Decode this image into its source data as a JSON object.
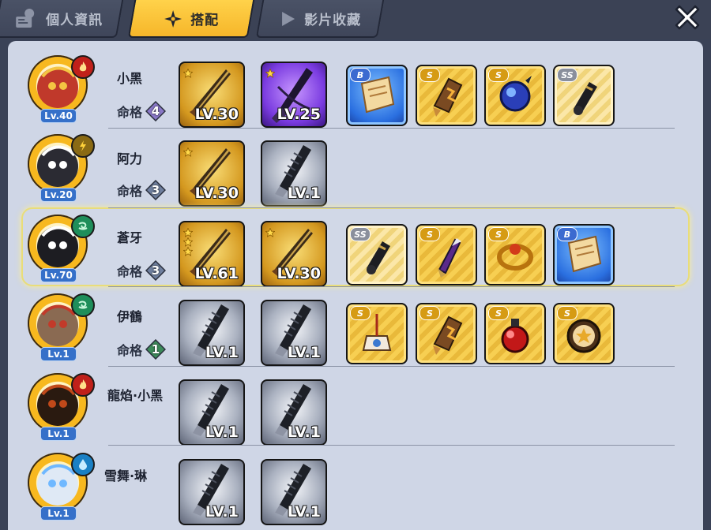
{
  "tabs": [
    {
      "label": "個人資訊",
      "active": false
    },
    {
      "label": "搭配",
      "active": true
    },
    {
      "label": "影片收藏",
      "active": false
    }
  ],
  "close_icon": "close-icon",
  "mingge_label": "命格",
  "characters": [
    {
      "name": "小黑",
      "level": "Lv.40",
      "element": "fire",
      "element_color": "#c0201a",
      "mingge": "4",
      "mingge_color": "#8a78c7",
      "weapons": [
        {
          "level": "LV.30",
          "rarity": "gold",
          "stars": 1
        },
        {
          "level": "LV.25",
          "rarity": "purple",
          "stars": 1
        }
      ],
      "items": [
        {
          "grade": "B",
          "style": "blue",
          "icon": "scroll-icon"
        },
        {
          "grade": "S",
          "style": "gold",
          "icon": "bracer-icon"
        },
        {
          "grade": "S",
          "style": "gold",
          "icon": "orb-icon"
        },
        {
          "grade": "SS",
          "style": "ss",
          "icon": "cannon-icon"
        }
      ]
    },
    {
      "name": "阿力",
      "level": "Lv.20",
      "element": "thunder",
      "element_color": "#8a6a14",
      "mingge": "3",
      "mingge_color": "#6f7f9e",
      "weapons": [
        {
          "level": "LV.30",
          "rarity": "gold",
          "stars": 1
        },
        {
          "level": "LV.1",
          "rarity": "gray",
          "stars": 0
        }
      ],
      "items": []
    },
    {
      "name": "蒼牙",
      "level": "Lv.70",
      "element": "wind",
      "element_color": "#1e8e5a",
      "mingge": "3",
      "mingge_color": "#6f7f9e",
      "weapons": [
        {
          "level": "LV.61",
          "rarity": "gold",
          "stars": 3
        },
        {
          "level": "LV.30",
          "rarity": "gold",
          "stars": 1
        }
      ],
      "items": [
        {
          "grade": "SS",
          "style": "ss",
          "icon": "cannon-icon"
        },
        {
          "grade": "S",
          "style": "gold",
          "icon": "blade-icon"
        },
        {
          "grade": "S",
          "style": "gold",
          "icon": "ring-icon"
        },
        {
          "grade": "B",
          "style": "blue",
          "icon": "scroll-icon"
        }
      ]
    },
    {
      "name": "伊鶴",
      "level": "Lv.1",
      "element": "wind",
      "element_color": "#1e8e5a",
      "mingge": "1",
      "mingge_color": "#3c8a5a",
      "weapons": [
        {
          "level": "LV.1",
          "rarity": "gray",
          "stars": 0
        },
        {
          "level": "LV.1",
          "rarity": "gray",
          "stars": 0
        }
      ],
      "items": [
        {
          "grade": "S",
          "style": "gold",
          "icon": "charm-icon"
        },
        {
          "grade": "S",
          "style": "gold",
          "icon": "bracer-icon"
        },
        {
          "grade": "S",
          "style": "gold",
          "icon": "potion-icon"
        },
        {
          "grade": "S",
          "style": "gold",
          "icon": "drum-icon"
        }
      ]
    },
    {
      "name": "龍焰·小黑",
      "level": "Lv.1",
      "element": "fire",
      "element_color": "#c0201a",
      "mingge": "",
      "mingge_color": "",
      "weapons": [
        {
          "level": "LV.1",
          "rarity": "gray",
          "stars": 0
        },
        {
          "level": "LV.1",
          "rarity": "gray",
          "stars": 0
        }
      ],
      "items": []
    },
    {
      "name": "雪舞·琳",
      "level": "Lv.1",
      "element": "water",
      "element_color": "#1a80c4",
      "mingge": "",
      "mingge_color": "",
      "weapons": [
        {
          "level": "LV.1",
          "rarity": "gray",
          "stars": 0
        },
        {
          "level": "LV.1",
          "rarity": "gray",
          "stars": 0
        }
      ],
      "items": []
    }
  ]
}
